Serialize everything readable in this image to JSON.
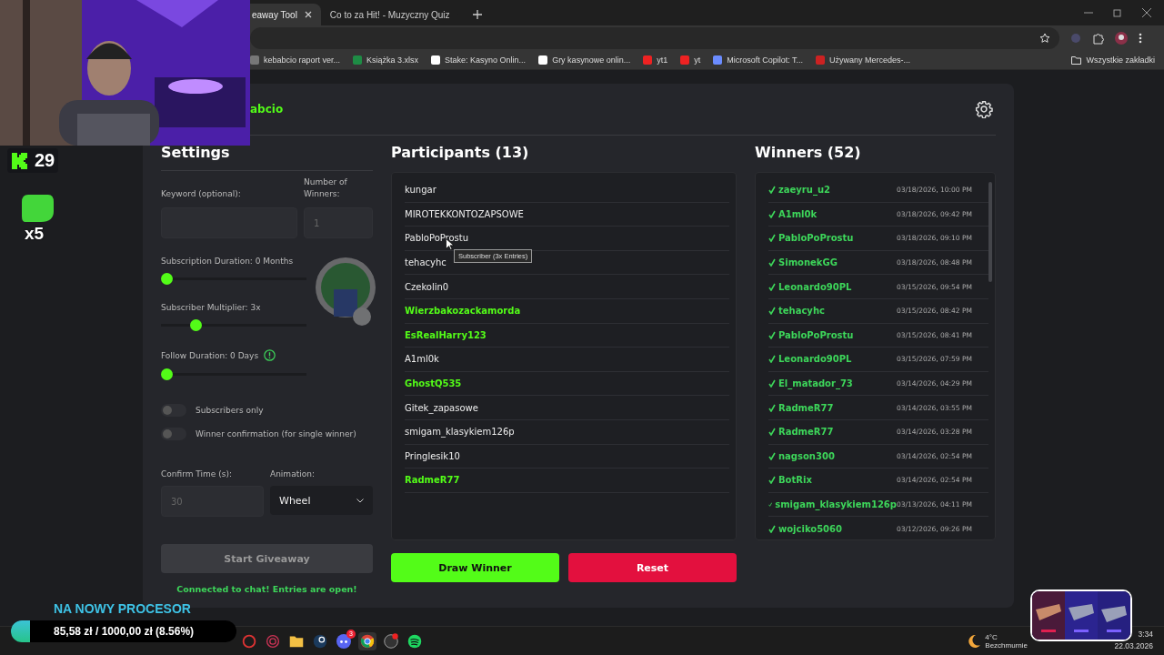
{
  "browser": {
    "tabs": [
      {
        "title": "eaway Tool",
        "selected": true
      },
      {
        "title": "Co to za Hit! - Muzyczny Quiz",
        "selected": false
      }
    ],
    "bookmarks": [
      "kebabcio raport ver...",
      "Książka 3.xlsx",
      "Stake: Kasyno Onlin...",
      "Gry kasynowe onlin...",
      "yt1",
      "yt",
      "Microsoft Copilot: T...",
      "Używany Mercedes-..."
    ],
    "all_bookmarks": "Wszystkie zakładki"
  },
  "app": {
    "title": "abcio",
    "settings": {
      "heading": "Settings",
      "keyword": {
        "label": "Keyword (optional):"
      },
      "winners_count": {
        "label": "Number of Winners:",
        "placeholder": "1"
      },
      "sliders": [
        {
          "label": "Subscription Duration: 0 Months",
          "level": 0,
          "info_icon": false
        },
        {
          "label": "Subscriber Multiplier: 3x",
          "level": 0.22,
          "info_icon": false
        },
        {
          "label": "Follow Duration:  0  Days",
          "level": 0,
          "info_icon": true
        }
      ],
      "toggles": [
        {
          "label": "Subscribers only",
          "on": false
        },
        {
          "label": "Winner confirmation (for single winner)",
          "on": false
        }
      ],
      "confirm_time": {
        "label": "Confirm Time (s):",
        "placeholder": "30"
      },
      "animation": {
        "label": "Animation:",
        "value": "Wheel"
      },
      "start_button": {
        "label": "Start Giveaway",
        "disabled": true
      },
      "status": "Connected to chat! Entries are open!"
    },
    "participants": {
      "heading": "Participants (13)",
      "items": [
        {
          "name": "kungar",
          "subscriber": false
        },
        {
          "name": "MIROTEKKONTOZAPSOWE",
          "subscriber": false
        },
        {
          "name": "PabloPoProstu",
          "subscriber": false
        },
        {
          "name": "tehacyhc",
          "subscriber": false
        },
        {
          "name": "Czekolin0",
          "subscriber": false
        },
        {
          "name": "Wierzbakozackamorda",
          "subscriber": true
        },
        {
          "name": "EsRealHarry123",
          "subscriber": true
        },
        {
          "name": "A1ml0k",
          "subscriber": false
        },
        {
          "name": "GhostQ535",
          "subscriber": true
        },
        {
          "name": "Gitek_zapasowe",
          "subscriber": false
        },
        {
          "name": "smigam_klasykiem126p",
          "subscriber": false
        },
        {
          "name": "Pringlesik10",
          "subscriber": false
        },
        {
          "name": "RadmeR77",
          "subscriber": true
        }
      ]
    },
    "winners": {
      "heading": "Winners (52)",
      "items": [
        {
          "name": "zaeyru_u2",
          "date": "03/18/2026, 10:00 PM"
        },
        {
          "name": "A1ml0k",
          "date": "03/18/2026, 09:42 PM"
        },
        {
          "name": "PabloPoProstu",
          "date": "03/18/2026, 09:10 PM"
        },
        {
          "name": "SimonekGG",
          "date": "03/18/2026, 08:48 PM"
        },
        {
          "name": "Leonardo90PL",
          "date": "03/15/2026, 09:54 PM"
        },
        {
          "name": "tehacyhc",
          "date": "03/15/2026, 08:42 PM"
        },
        {
          "name": "PabloPoProstu",
          "date": "03/15/2026, 08:41 PM"
        },
        {
          "name": "Leonardo90PL",
          "date": "03/15/2026, 07:59 PM"
        },
        {
          "name": "El_matador_73",
          "date": "03/14/2026, 04:29 PM"
        },
        {
          "name": "RadmeR77",
          "date": "03/14/2026, 03:55 PM"
        },
        {
          "name": "RadmeR77",
          "date": "03/14/2026, 03:28 PM"
        },
        {
          "name": "nagson300",
          "date": "03/14/2026, 02:54 PM"
        },
        {
          "name": "BotRix",
          "date": "03/14/2026, 02:54 PM"
        },
        {
          "name": "smigam_klasykiem126p",
          "date": "03/13/2026, 04:11 PM"
        },
        {
          "name": "wojciko5060",
          "date": "03/12/2026, 09:26 PM"
        }
      ]
    },
    "draw_button": "Draw Winner",
    "reset_button": "Reset"
  },
  "tooltip": "Subscriber (3x Entries)",
  "stream_overlay": {
    "follower_count": "29",
    "emote_multiplier": "x5",
    "goal_title": "NA NOWY PROCESOR",
    "goal_progress": "85,58 zł / 1000,00 zł (8.56%)",
    "level": 0.0856
  },
  "taskbar": {
    "discord_badge": "3",
    "temperature": "4°C",
    "weather": "Bezchmurnie",
    "time": "3:34",
    "date": "22.03.2026"
  }
}
